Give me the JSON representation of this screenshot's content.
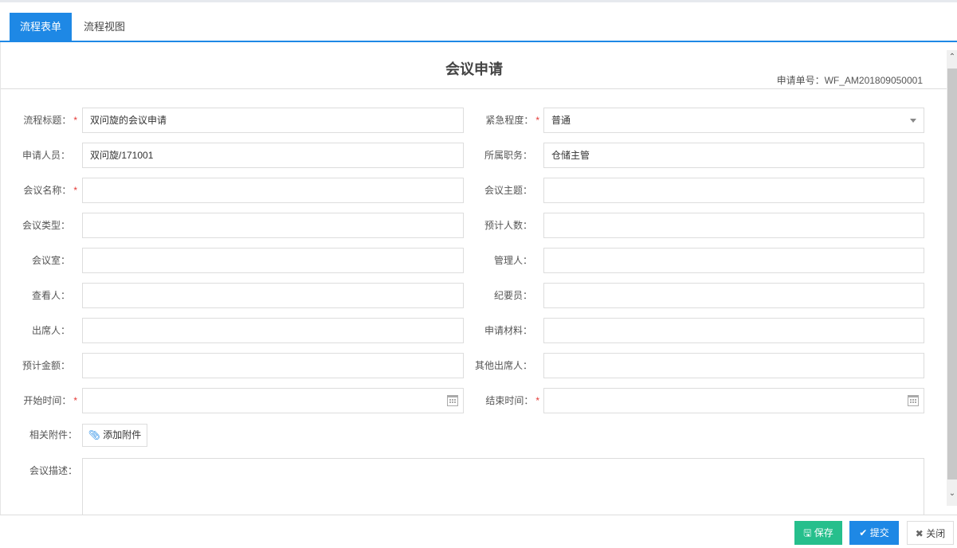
{
  "tabs": [
    "流程表单",
    "流程视图"
  ],
  "form": {
    "title": "会议申请",
    "doc_no": "申请单号：WF_AM201809050001",
    "rows": [
      {
        "left": {
          "label": "流程标题：",
          "required": true,
          "value": "双问旋的会议申请"
        },
        "right": {
          "label": "紧急程度：",
          "required": true,
          "value": "普通",
          "type": "select"
        }
      },
      {
        "left": {
          "label": "申请人员：",
          "value": "双问旋/171001"
        },
        "right": {
          "label": "所属职务：",
          "value": "仓储主管"
        }
      },
      {
        "left": {
          "label": "会议名称：",
          "required": true,
          "value": ""
        },
        "right": {
          "label": "会议主题：",
          "value": ""
        }
      },
      {
        "left": {
          "label": "会议类型：",
          "value": ""
        },
        "right": {
          "label": "预计人数：",
          "value": ""
        }
      },
      {
        "left": {
          "label": "会议室：",
          "value": ""
        },
        "right": {
          "label": "管理人：",
          "value": ""
        }
      },
      {
        "left": {
          "label": "查看人：",
          "value": ""
        },
        "right": {
          "label": "纪要员：",
          "value": ""
        }
      },
      {
        "left": {
          "label": "出席人：",
          "value": ""
        },
        "right": {
          "label": "申请材料：",
          "value": ""
        }
      },
      {
        "left": {
          "label": "预计金额：",
          "value": ""
        },
        "right": {
          "label": "其他出席人：",
          "value": ""
        }
      },
      {
        "left": {
          "label": "开始时间：",
          "required": true,
          "value": "",
          "type": "date"
        },
        "right": {
          "label": "结束时间：",
          "required": true,
          "value": "",
          "type": "date"
        }
      }
    ],
    "required_mark": "*",
    "attachments_label": "相关附件：",
    "attach_button": "添加附件",
    "description_label": "会议描述："
  },
  "footer": {
    "save": "保存",
    "submit": "提交",
    "close": "关闭"
  },
  "colors": {
    "primary": "#1e88e5",
    "success": "#26bf8c",
    "required": "#e53935"
  }
}
